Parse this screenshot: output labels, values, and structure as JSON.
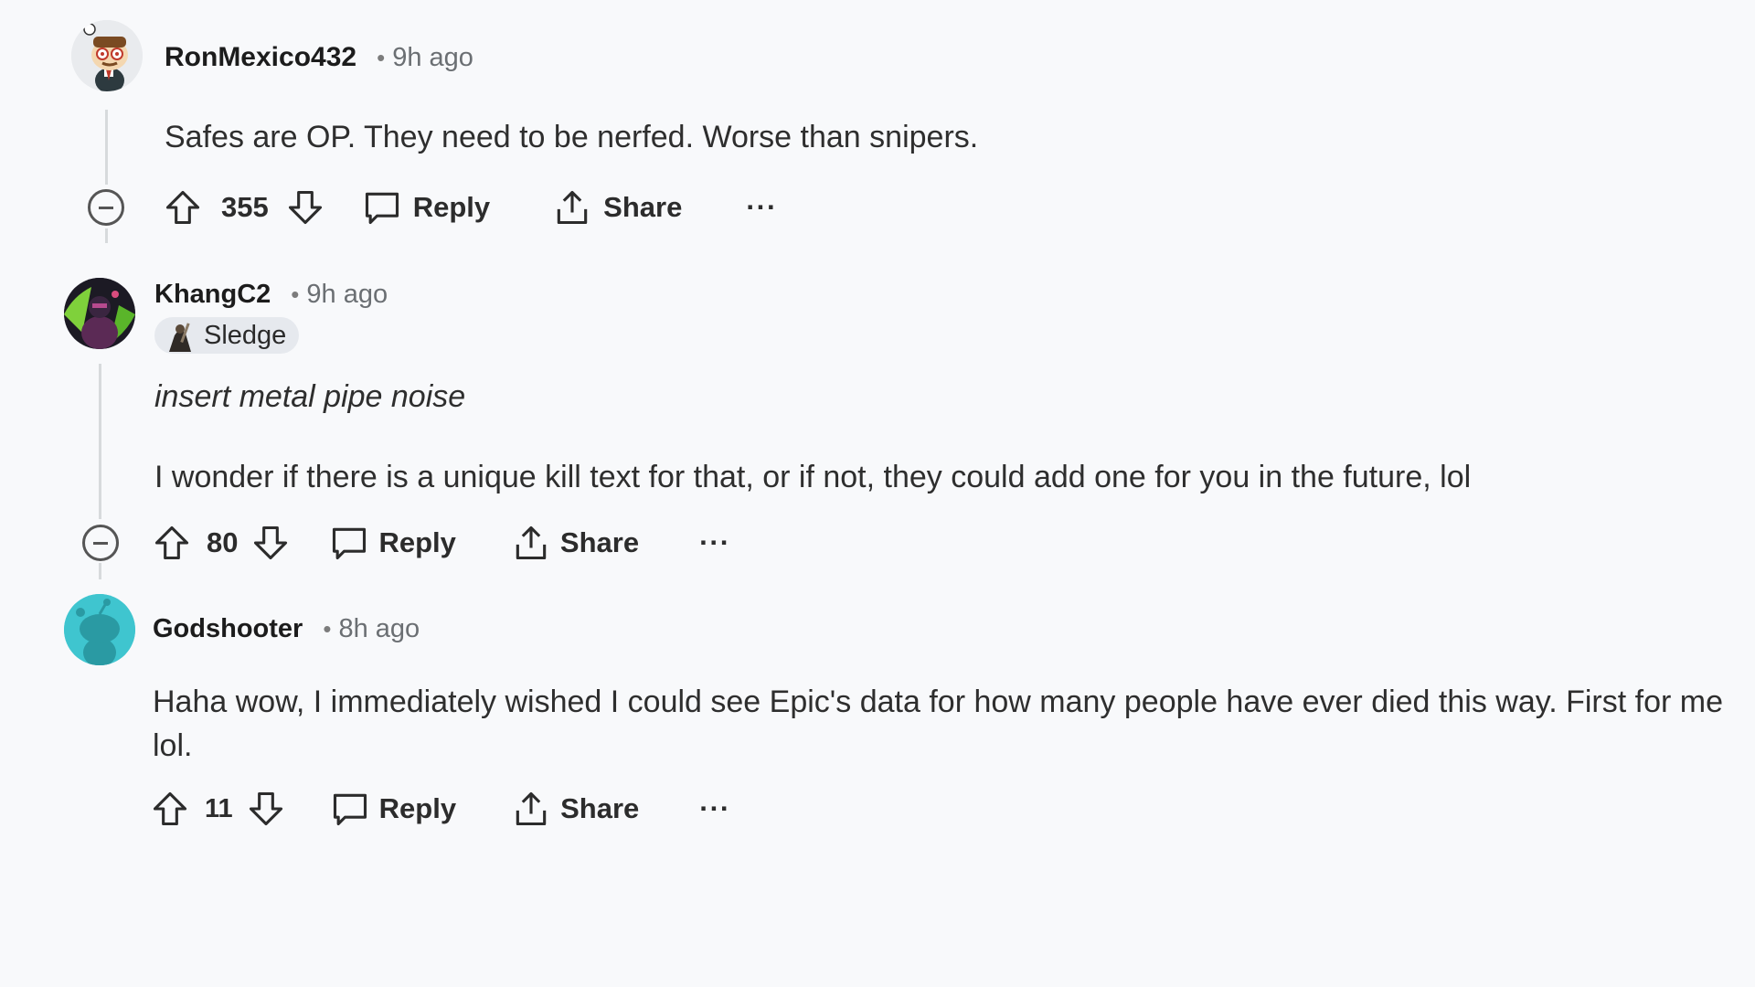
{
  "comments": [
    {
      "username": "RonMexico432",
      "time": "9h ago",
      "separator": "•",
      "paragraphs": [
        "Safes are OP. They need to be nerfed. Worse than snipers."
      ],
      "votes": "355",
      "reply_label": "Reply",
      "share_label": "Share",
      "more_label": "···"
    },
    {
      "username": "KhangC2",
      "time": "9h ago",
      "separator": "•",
      "flair": "Sledge",
      "paragraphs": [
        "insert metal pipe noise",
        "I wonder if there is a unique kill text for that, or if not, they could add one for you in the future, lol"
      ],
      "votes": "80",
      "reply_label": "Reply",
      "share_label": "Share",
      "more_label": "···"
    },
    {
      "username": "Godshooter",
      "time": "8h ago",
      "separator": "•",
      "paragraphs": [
        "Haha wow, I immediately wished I could see Epic's data for how many people have ever died this way. First for me",
        "lol."
      ],
      "votes": "11",
      "reply_label": "Reply",
      "share_label": "Share",
      "more_label": "···"
    }
  ],
  "colors": {
    "background": "#f8f9fb",
    "thread_line": "#d7dadc",
    "flair_bg": "#e6e9ee",
    "avatar_godshooter": "#3fc5cf"
  }
}
